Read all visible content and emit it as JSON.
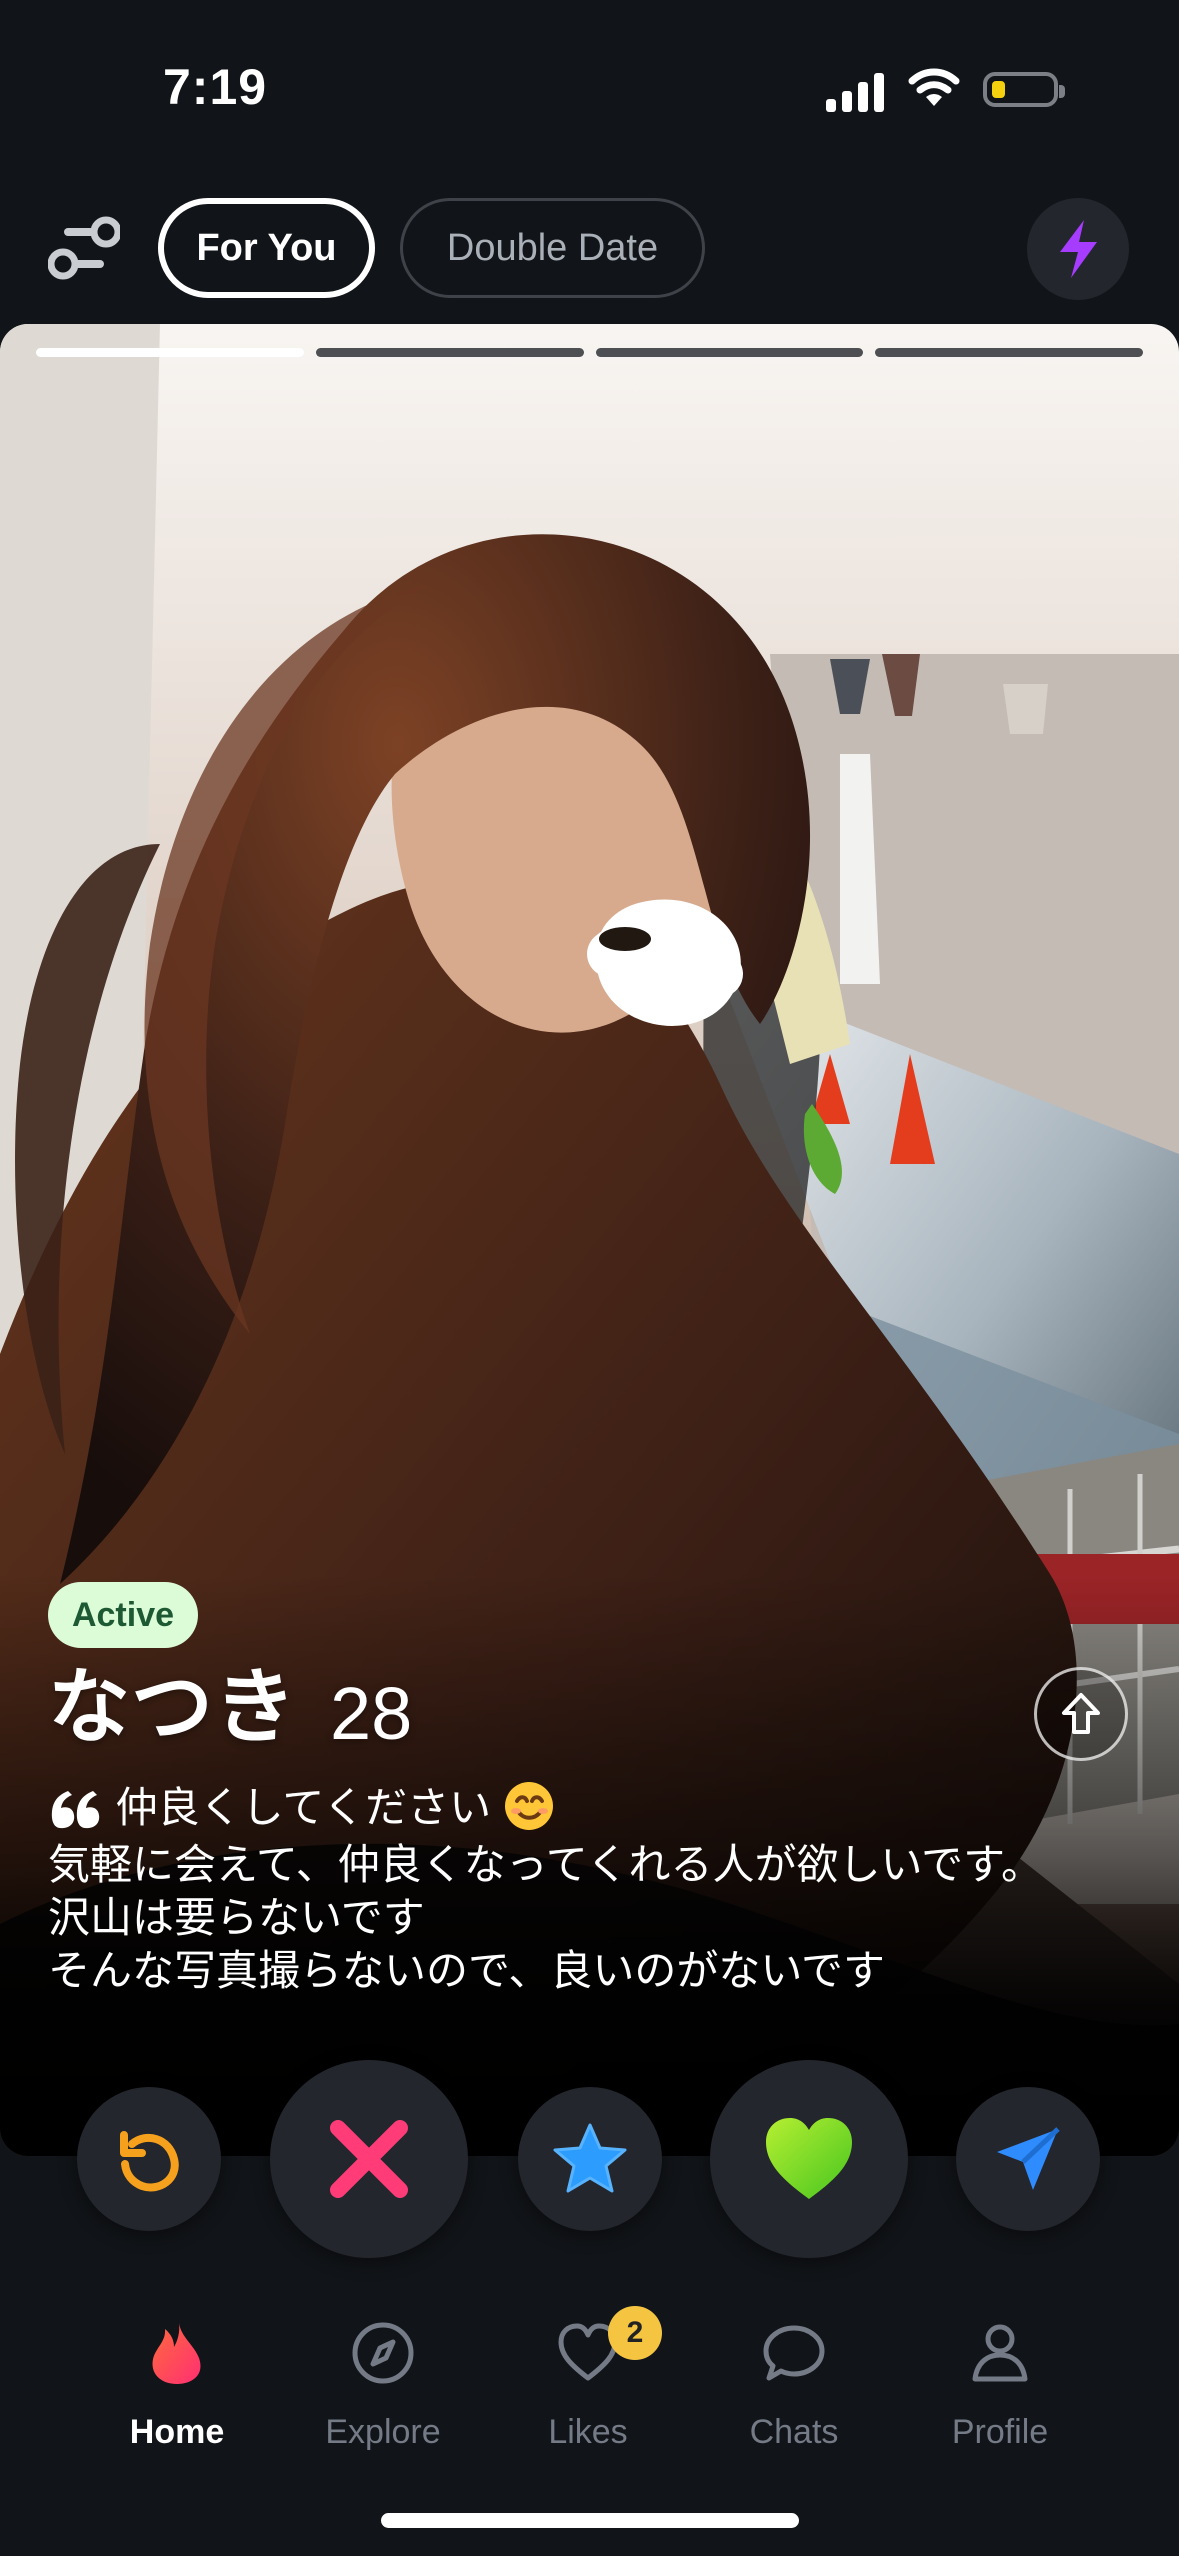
{
  "status_bar": {
    "time": "7:19",
    "signal_icon": "signal-icon",
    "wifi_icon": "wifi-icon",
    "battery_icon": "battery-icon",
    "battery_level": 0.15
  },
  "header": {
    "filter_icon": "sliders-icon",
    "tabs": [
      {
        "label": "For You",
        "selected": true
      },
      {
        "label": "Double Date",
        "selected": false
      }
    ],
    "boost_icon": "lightning-icon",
    "boost_color": "#a63cff"
  },
  "profile_card": {
    "photo_count": 4,
    "current_photo": 1,
    "active_label": "Active",
    "name": "なつき",
    "age": "28",
    "info_icon": "arrow-up-icon",
    "bio": {
      "line1": "仲良くしてください",
      "line2": "気軽に会えて、仲良くなってくれる人が欲しいです。",
      "line3": "沢山は要らないです",
      "line4": "そんな写真撮らないので、良いのがないです"
    }
  },
  "actions": [
    {
      "name": "rewind",
      "icon": "rewind-icon",
      "color": "#f6a11d"
    },
    {
      "name": "nope",
      "icon": "x-icon",
      "color": "#ff3c78"
    },
    {
      "name": "super-like",
      "icon": "star-icon",
      "color": "#2d9cff"
    },
    {
      "name": "like",
      "icon": "heart-icon",
      "color": "#7ed321"
    },
    {
      "name": "boost",
      "icon": "send-icon",
      "color": "#2f8cff"
    }
  ],
  "bottom_nav": {
    "items": [
      {
        "label": "Home",
        "icon": "flame-icon",
        "active": true
      },
      {
        "label": "Explore",
        "icon": "compass-icon",
        "active": false
      },
      {
        "label": "Likes",
        "icon": "heart-outline-icon",
        "active": false,
        "badge": "2"
      },
      {
        "label": "Chats",
        "icon": "chat-icon",
        "active": false
      },
      {
        "label": "Profile",
        "icon": "user-icon",
        "active": false
      }
    ]
  },
  "colors": {
    "background": "#111418",
    "active_badge_bg": "#dcfbd7",
    "active_badge_text": "#1d5a34",
    "likes_badge": "#f5c542",
    "home_icon": "#ff3d67"
  }
}
